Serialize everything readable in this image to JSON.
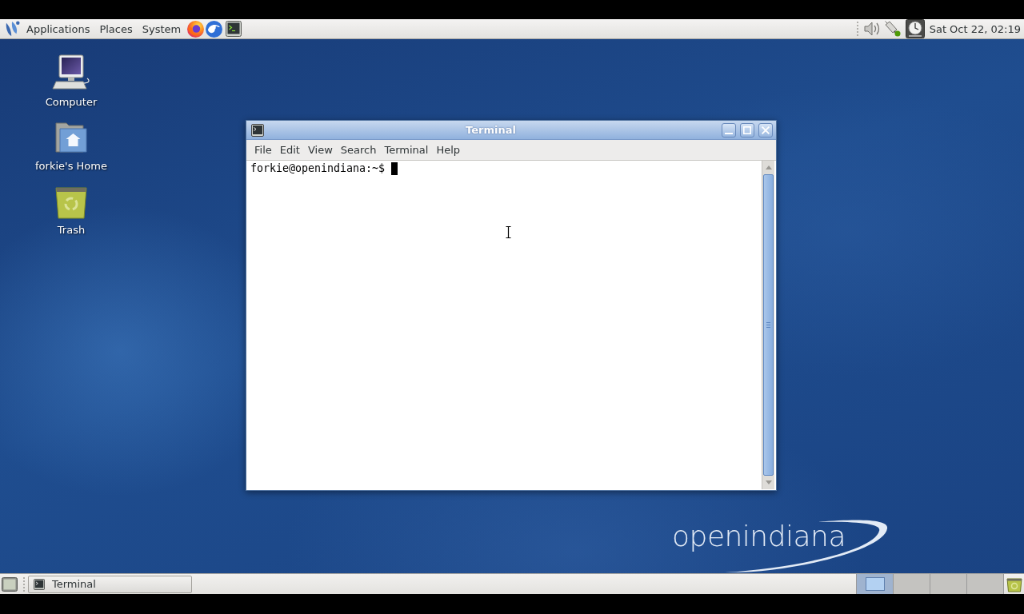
{
  "top_panel": {
    "menus": [
      "Applications",
      "Places",
      "System"
    ],
    "clock": "Sat Oct 22, 02:19"
  },
  "desktop_icons": [
    {
      "kind": "computer",
      "label": "Computer"
    },
    {
      "kind": "home",
      "label": "forkie's Home"
    },
    {
      "kind": "trash",
      "label": "Trash"
    }
  ],
  "window": {
    "title": "Terminal",
    "menus": [
      "File",
      "Edit",
      "View",
      "Search",
      "Terminal",
      "Help"
    ],
    "prompt": "forkie@openindiana:~$"
  },
  "wallpaper": {
    "logo": "openindiana"
  },
  "bottom_panel": {
    "tasks": [
      {
        "label": "Terminal"
      }
    ],
    "workspaces": [
      {
        "selected": true
      },
      {
        "selected": false
      },
      {
        "selected": false
      },
      {
        "selected": false
      }
    ]
  }
}
